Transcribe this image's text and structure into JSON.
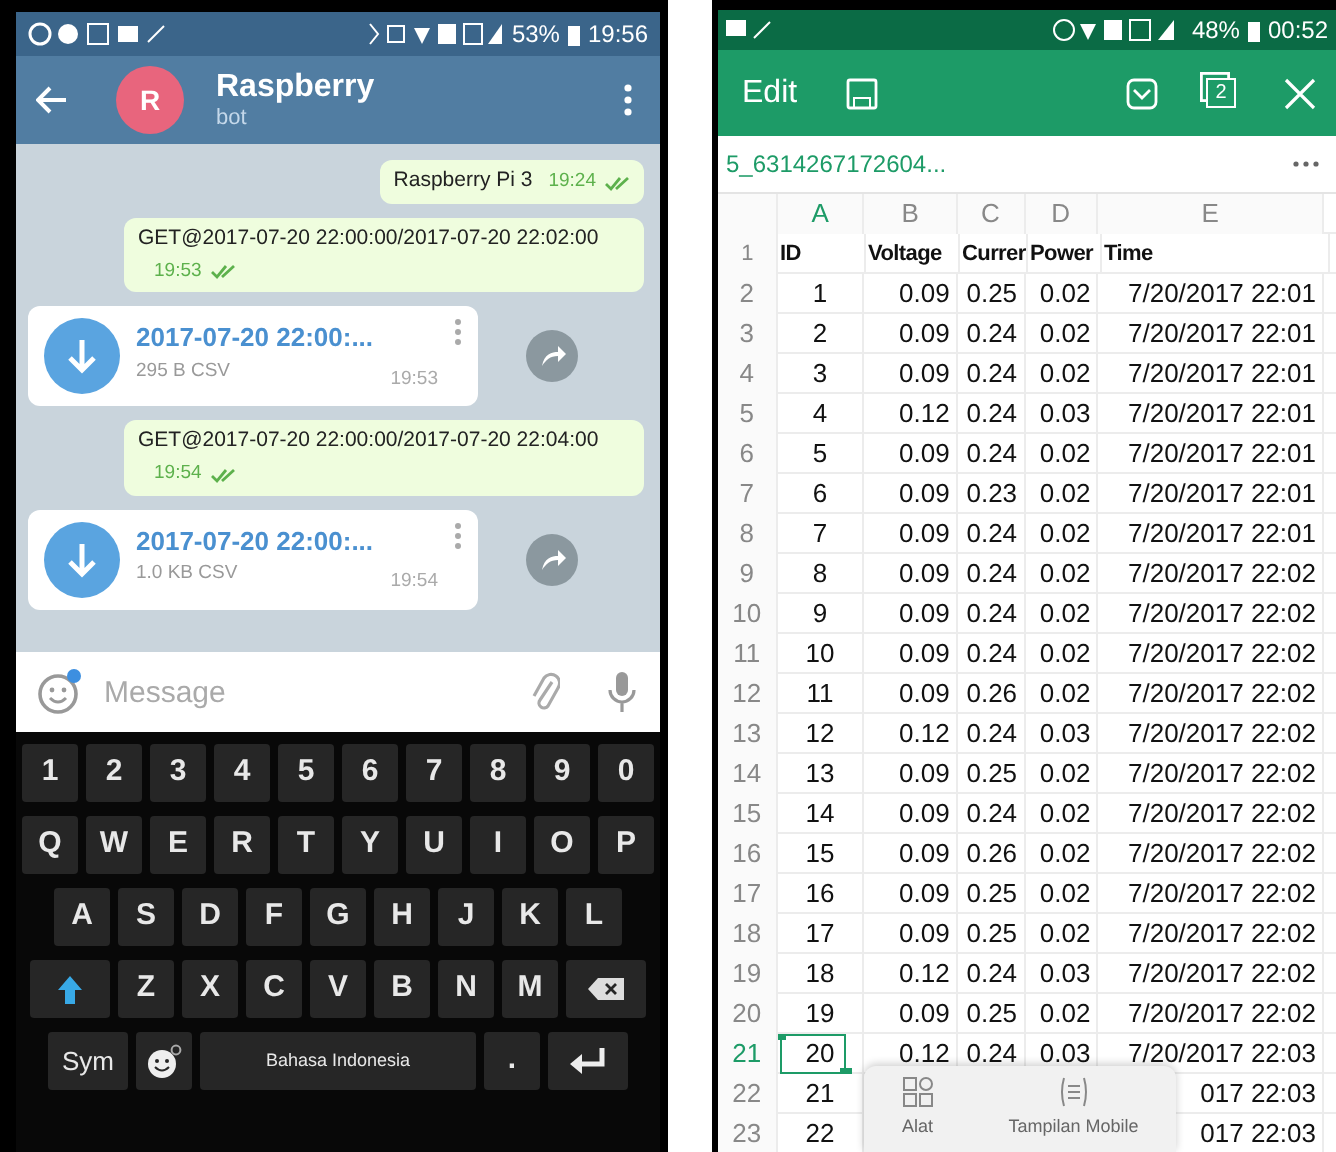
{
  "left_phone": {
    "status_bar": {
      "battery": "53%",
      "time": "19:56"
    },
    "header": {
      "avatar": "R",
      "title": "Raspberry",
      "subtitle": "bot"
    },
    "messages": [
      {
        "kind": "text",
        "text": "Raspberry Pi 3",
        "time": "19:24",
        "read": true
      },
      {
        "kind": "text",
        "text": "GET@2017-07-20 22:00:00/2017-07-20 22:02:00",
        "time": "19:53",
        "read": true
      },
      {
        "kind": "file",
        "name": "2017-07-20 22:00:...",
        "size": "295 B CSV",
        "time": "19:53"
      },
      {
        "kind": "text",
        "text": "GET@2017-07-20 22:00:00/2017-07-20 22:04:00",
        "time": "19:54",
        "read": true
      },
      {
        "kind": "file",
        "name": "2017-07-20 22:00:...",
        "size": "1.0 KB CSV",
        "time": "19:54"
      }
    ],
    "composer": {
      "placeholder": "Message"
    },
    "keyboard": {
      "rows": [
        {
          "keys": [
            {
              "kind": "char",
              "label": "1"
            },
            {
              "kind": "char",
              "label": "2"
            },
            {
              "kind": "char",
              "label": "3"
            },
            {
              "kind": "char",
              "label": "4"
            },
            {
              "kind": "char",
              "label": "5"
            },
            {
              "kind": "char",
              "label": "6"
            },
            {
              "kind": "char",
              "label": "7"
            },
            {
              "kind": "char",
              "label": "8"
            },
            {
              "kind": "char",
              "label": "9"
            },
            {
              "kind": "char",
              "label": "0"
            }
          ]
        },
        {
          "keys": [
            {
              "kind": "char",
              "label": "Q"
            },
            {
              "kind": "char",
              "label": "W"
            },
            {
              "kind": "char",
              "label": "E"
            },
            {
              "kind": "char",
              "label": "R"
            },
            {
              "kind": "char",
              "label": "T"
            },
            {
              "kind": "char",
              "label": "Y"
            },
            {
              "kind": "char",
              "label": "U"
            },
            {
              "kind": "char",
              "label": "I"
            },
            {
              "kind": "char",
              "label": "O"
            },
            {
              "kind": "char",
              "label": "P"
            }
          ]
        },
        {
          "keys": [
            {
              "kind": "char",
              "label": "A"
            },
            {
              "kind": "char",
              "label": "S"
            },
            {
              "kind": "char",
              "label": "D"
            },
            {
              "kind": "char",
              "label": "F"
            },
            {
              "kind": "char",
              "label": "G"
            },
            {
              "kind": "char",
              "label": "H"
            },
            {
              "kind": "char",
              "label": "J"
            },
            {
              "kind": "char",
              "label": "K"
            },
            {
              "kind": "char",
              "label": "L"
            }
          ]
        },
        {
          "keys": [
            {
              "kind": "shift"
            },
            {
              "kind": "char",
              "label": "Z"
            },
            {
              "kind": "char",
              "label": "X"
            },
            {
              "kind": "char",
              "label": "C"
            },
            {
              "kind": "char",
              "label": "V"
            },
            {
              "kind": "char",
              "label": "B"
            },
            {
              "kind": "char",
              "label": "N"
            },
            {
              "kind": "char",
              "label": "M"
            },
            {
              "kind": "backspace"
            }
          ]
        },
        {
          "keys": [
            {
              "kind": "mode",
              "label": "Sym"
            },
            {
              "kind": "emoji"
            },
            {
              "kind": "space",
              "label": "Bahasa Indonesia"
            },
            {
              "kind": "char",
              "label": "."
            },
            {
              "kind": "enter"
            }
          ]
        }
      ]
    }
  },
  "right_phone": {
    "status_bar": {
      "battery": "48%",
      "time": "00:52"
    },
    "toolbar": {
      "edit": "Edit",
      "window_count": "2"
    },
    "file_name": "5_6314267172604...",
    "sheet": {
      "columns": [
        {
          "label": "A",
          "selected": true
        },
        {
          "label": "B",
          "selected": false
        },
        {
          "label": "C",
          "selected": false
        },
        {
          "label": "D",
          "selected": false
        },
        {
          "label": "E",
          "selected": false
        }
      ],
      "rows": [
        {
          "header": "1",
          "kind": "header",
          "selected": false,
          "a": "ID",
          "b": "Voltage",
          "c": "Currer",
          "d": "Power",
          "e": "Time"
        },
        {
          "header": "2",
          "kind": "data",
          "selected": false,
          "a": "1",
          "b": "0.09",
          "c": "0.25",
          "d": "0.02",
          "e": "7/20/2017 22:01"
        },
        {
          "header": "3",
          "kind": "data",
          "selected": false,
          "a": "2",
          "b": "0.09",
          "c": "0.24",
          "d": "0.02",
          "e": "7/20/2017 22:01"
        },
        {
          "header": "4",
          "kind": "data",
          "selected": false,
          "a": "3",
          "b": "0.09",
          "c": "0.24",
          "d": "0.02",
          "e": "7/20/2017 22:01"
        },
        {
          "header": "5",
          "kind": "data",
          "selected": false,
          "a": "4",
          "b": "0.12",
          "c": "0.24",
          "d": "0.03",
          "e": "7/20/2017 22:01"
        },
        {
          "header": "6",
          "kind": "data",
          "selected": false,
          "a": "5",
          "b": "0.09",
          "c": "0.24",
          "d": "0.02",
          "e": "7/20/2017 22:01"
        },
        {
          "header": "7",
          "kind": "data",
          "selected": false,
          "a": "6",
          "b": "0.09",
          "c": "0.23",
          "d": "0.02",
          "e": "7/20/2017 22:01"
        },
        {
          "header": "8",
          "kind": "data",
          "selected": false,
          "a": "7",
          "b": "0.09",
          "c": "0.24",
          "d": "0.02",
          "e": "7/20/2017 22:01"
        },
        {
          "header": "9",
          "kind": "data",
          "selected": false,
          "a": "8",
          "b": "0.09",
          "c": "0.24",
          "d": "0.02",
          "e": "7/20/2017 22:02"
        },
        {
          "header": "10",
          "kind": "data",
          "selected": false,
          "a": "9",
          "b": "0.09",
          "c": "0.24",
          "d": "0.02",
          "e": "7/20/2017 22:02"
        },
        {
          "header": "11",
          "kind": "data",
          "selected": false,
          "a": "10",
          "b": "0.09",
          "c": "0.24",
          "d": "0.02",
          "e": "7/20/2017 22:02"
        },
        {
          "header": "12",
          "kind": "data",
          "selected": false,
          "a": "11",
          "b": "0.09",
          "c": "0.26",
          "d": "0.02",
          "e": "7/20/2017 22:02"
        },
        {
          "header": "13",
          "kind": "data",
          "selected": false,
          "a": "12",
          "b": "0.12",
          "c": "0.24",
          "d": "0.03",
          "e": "7/20/2017 22:02"
        },
        {
          "header": "14",
          "kind": "data",
          "selected": false,
          "a": "13",
          "b": "0.09",
          "c": "0.25",
          "d": "0.02",
          "e": "7/20/2017 22:02"
        },
        {
          "header": "15",
          "kind": "data",
          "selected": false,
          "a": "14",
          "b": "0.09",
          "c": "0.24",
          "d": "0.02",
          "e": "7/20/2017 22:02"
        },
        {
          "header": "16",
          "kind": "data",
          "selected": false,
          "a": "15",
          "b": "0.09",
          "c": "0.26",
          "d": "0.02",
          "e": "7/20/2017 22:02"
        },
        {
          "header": "17",
          "kind": "data",
          "selected": false,
          "a": "16",
          "b": "0.09",
          "c": "0.25",
          "d": "0.02",
          "e": "7/20/2017 22:02"
        },
        {
          "header": "18",
          "kind": "data",
          "selected": false,
          "a": "17",
          "b": "0.09",
          "c": "0.25",
          "d": "0.02",
          "e": "7/20/2017 22:02"
        },
        {
          "header": "19",
          "kind": "data",
          "selected": false,
          "a": "18",
          "b": "0.12",
          "c": "0.24",
          "d": "0.03",
          "e": "7/20/2017 22:02"
        },
        {
          "header": "20",
          "kind": "data",
          "selected": false,
          "a": "19",
          "b": "0.09",
          "c": "0.25",
          "d": "0.02",
          "e": "7/20/2017 22:02"
        },
        {
          "header": "21",
          "kind": "data",
          "selected": true,
          "a": "20",
          "b": "0.12",
          "c": "0.24",
          "d": "0.03",
          "e": "7/20/2017 22:03"
        },
        {
          "header": "22",
          "kind": "data",
          "selected": false,
          "a": "21",
          "e": "017 22:03"
        },
        {
          "header": "23",
          "kind": "data",
          "selected": false,
          "a": "22",
          "e": "017 22:03"
        }
      ]
    },
    "popup": {
      "items": [
        {
          "kind": "tools",
          "label": "Alat"
        },
        {
          "kind": "mobile_view",
          "label": "Tampilan Mobile"
        }
      ]
    }
  }
}
